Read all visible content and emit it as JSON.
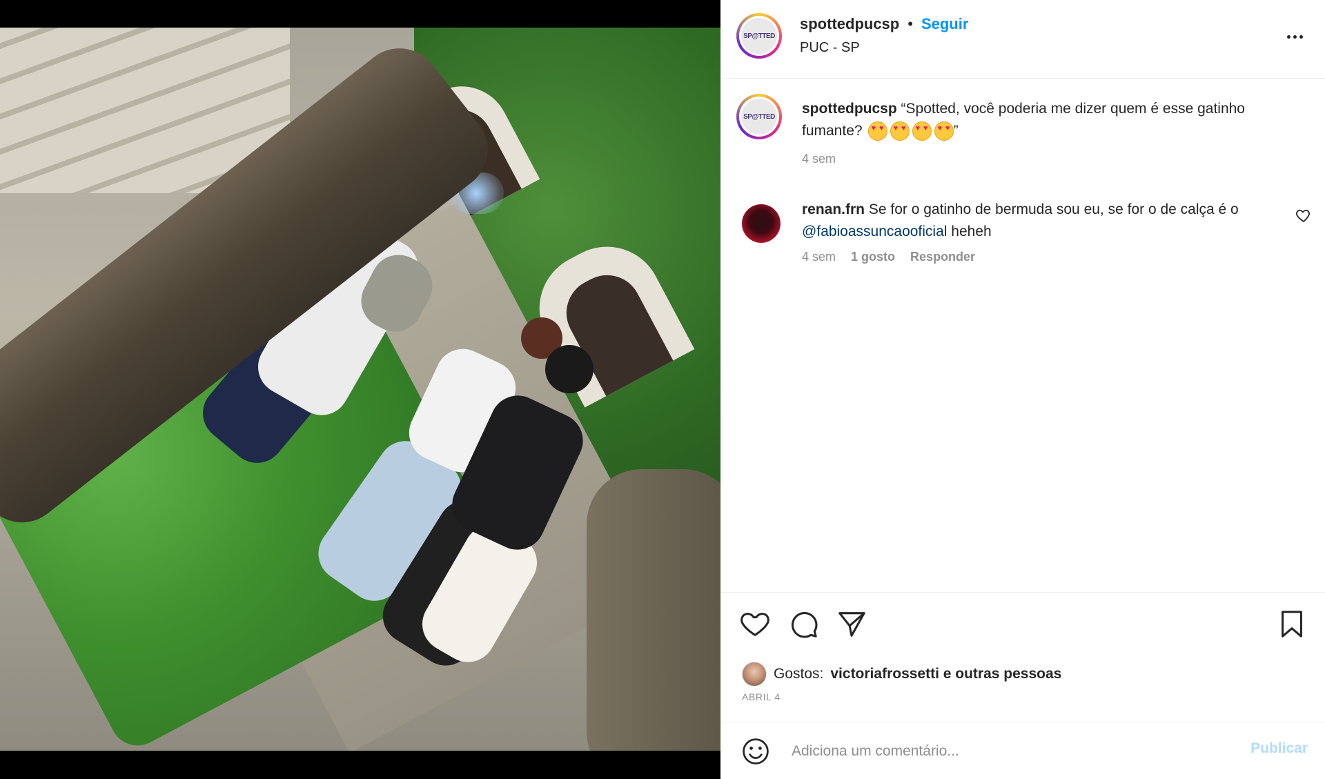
{
  "post": {
    "username": "spottedpucsp",
    "follow_label": "Seguir",
    "separator": "•",
    "location": "PUC - SP",
    "avatar_text": "SP@TTED"
  },
  "caption": {
    "username": "spottedpucsp",
    "text": "“Spotted, você poderia me dizer quem é esse gatinho fumante?",
    "closing_quote": "”",
    "emoji_count": 4,
    "time": "4 sem"
  },
  "comments": [
    {
      "username": "renan.frn",
      "text_before": "Se for o gatinho de bermuda sou eu, se for o de calça é o",
      "mention": "@fabioassuncaooficial",
      "text_after": "heheh",
      "time": "4 sem",
      "likes": "1 gosto",
      "reply_label": "Responder"
    }
  ],
  "likes": {
    "prefix": "Gostos:",
    "text": "victoriafrossetti e outras pessoas"
  },
  "date": "ABRIL 4",
  "add_comment": {
    "placeholder": "Adiciona um comentário...",
    "publish_label": "Publicar"
  },
  "icons": {
    "like": "heart-icon",
    "comment": "comment-icon",
    "share": "send-icon",
    "save": "bookmark-icon",
    "more": "more-horizontal-icon",
    "emoji": "smiley-icon"
  },
  "colors": {
    "accent": "#0095f6",
    "mention": "#00376b",
    "muted": "#8e8e8e",
    "publish_disabled": "#b3dbff"
  }
}
